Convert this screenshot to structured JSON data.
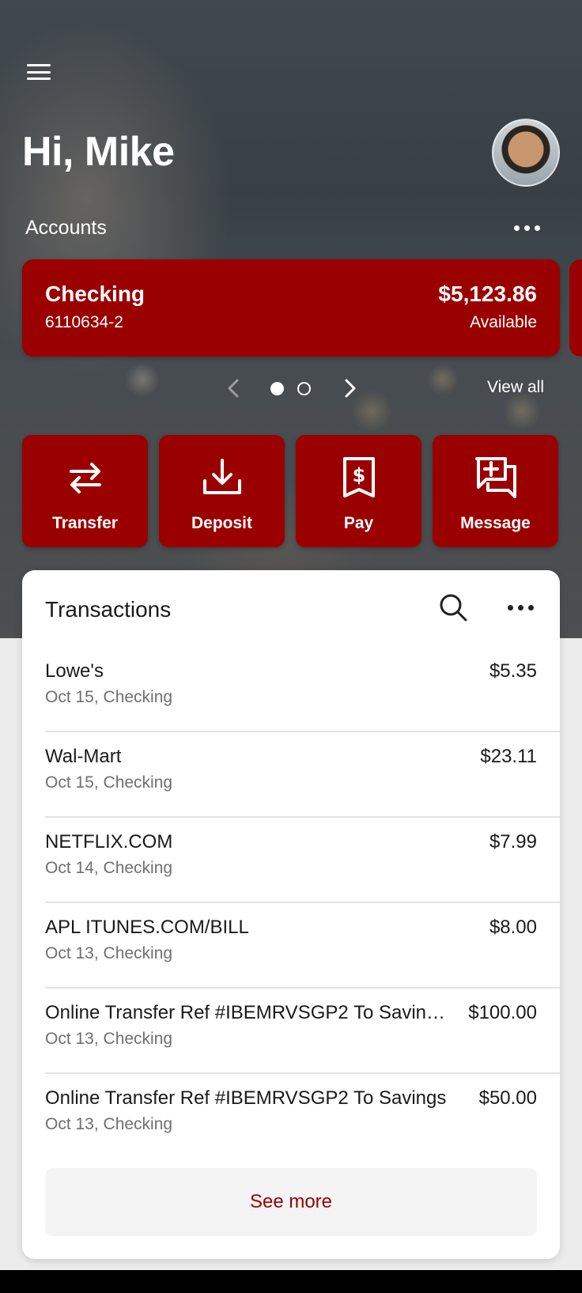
{
  "header": {
    "greeting": "Hi, Mike",
    "accounts_label": "Accounts",
    "menu_icon": "hamburger-menu-icon",
    "avatar_icon": "user-avatar"
  },
  "account_card": {
    "name": "Checking",
    "number": "6110634-2",
    "balance": "$5,123.86",
    "balance_label": "Available"
  },
  "pager": {
    "view_all": "View all",
    "page_count": 2,
    "current_page": 1
  },
  "actions": [
    {
      "label": "Transfer",
      "icon": "transfer-arrows-icon"
    },
    {
      "label": "Deposit",
      "icon": "download-deposit-icon"
    },
    {
      "label": "Pay",
      "icon": "dollar-receipt-icon"
    },
    {
      "label": "Message",
      "icon": "message-plus-icon"
    }
  ],
  "transactions": {
    "title": "Transactions",
    "items": [
      {
        "name": "Lowe's",
        "date": "Oct 15, Checking",
        "amount": "$5.35"
      },
      {
        "name": "Wal-Mart",
        "date": "Oct 15, Checking",
        "amount": "$23.11"
      },
      {
        "name": "NETFLIX.COM",
        "date": "Oct 14, Checking",
        "amount": "$7.99"
      },
      {
        "name": "APL ITUNES.COM/BILL",
        "date": "Oct 13, Checking",
        "amount": "$8.00"
      },
      {
        "name": "Online Transfer Ref #IBEMRVSGP2 To Savin…",
        "date": "Oct 13, Checking",
        "amount": "$100.00"
      },
      {
        "name": "Online Transfer Ref #IBEMRVSGP2 To Savings",
        "date": "Oct 13, Checking",
        "amount": "$50.00"
      }
    ],
    "see_more": "See more"
  },
  "colors": {
    "brand_red": "#9b0000",
    "card_bg": "#ffffff",
    "muted_text": "#6f6f6f"
  }
}
